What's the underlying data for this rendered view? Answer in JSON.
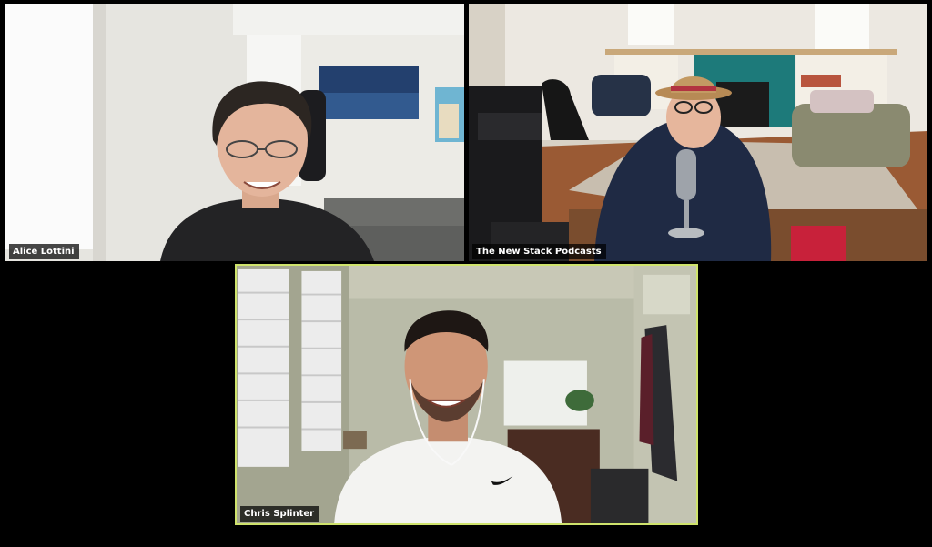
{
  "participants": [
    {
      "name": "Alice Lottini",
      "active_speaker": false
    },
    {
      "name": "The New Stack Podcasts",
      "active_speaker": false
    },
    {
      "name": "Chris Splinter",
      "active_speaker": true
    }
  ],
  "colors": {
    "background": "#000000",
    "active_speaker_border": "#cfe36c",
    "name_tag_bg": "rgba(0,0,0,0.72)",
    "name_tag_text": "#ffffff"
  }
}
